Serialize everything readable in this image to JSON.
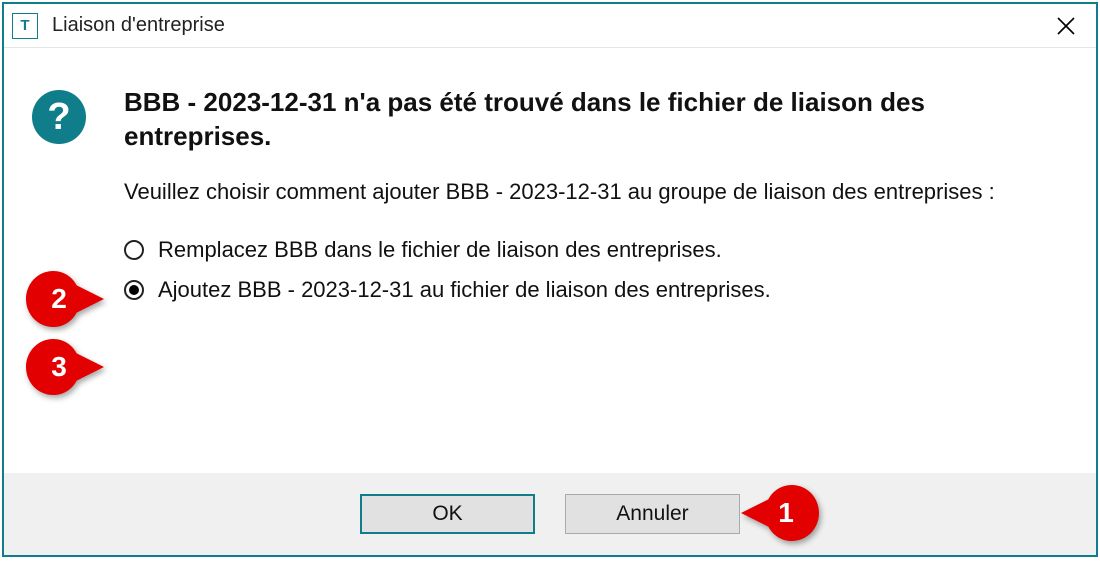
{
  "titlebar": {
    "title": "Liaison d'entreprise",
    "appLetter": "T"
  },
  "dialog": {
    "qmark": "?",
    "heading": "BBB - 2023-12-31 n'a pas été trouvé dans le fichier de liaison des entreprises.",
    "subtext": "Veuillez choisir comment ajouter BBB - 2023-12-31 au groupe de liaison des entreprises :",
    "options": [
      {
        "label": "Remplacez BBB dans le fichier de liaison des entreprises.",
        "selected": false
      },
      {
        "label": "Ajoutez BBB - 2023-12-31 au fichier de liaison des entreprises.",
        "selected": true
      }
    ]
  },
  "footer": {
    "ok": "OK",
    "cancel": "Annuler"
  },
  "callouts": {
    "one": "1",
    "two": "2",
    "three": "3"
  }
}
